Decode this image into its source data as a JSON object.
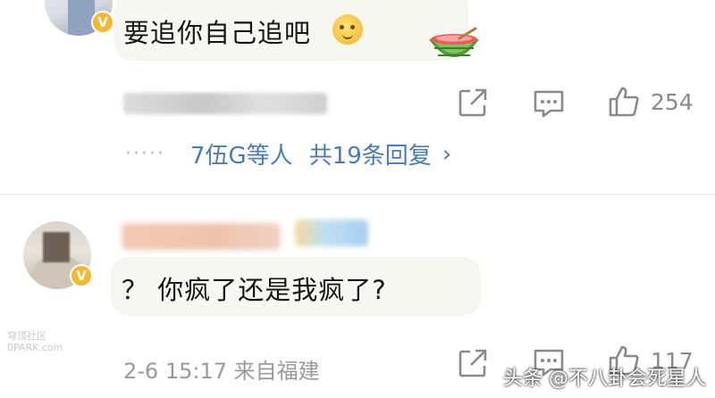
{
  "comment1": {
    "text": "要追你自己追吧",
    "like_count": "254",
    "replies": {
      "dots": "·····",
      "users": "7伍G等人",
      "total": "共19条回复",
      "arrow": "›"
    }
  },
  "comment2": {
    "text": "？ 你疯了还是我疯了?",
    "meta": "2-6 15:17  来自福建",
    "like_count": "117"
  },
  "watermarks": {
    "left_line1": "穹顶社区",
    "left_line2": "0PARK.com",
    "right": "头条 @不八卦会死星人"
  },
  "icons": {
    "share": "share-icon",
    "comment": "comment-icon",
    "like": "thumbs-up-icon",
    "verified": "verified-badge-icon"
  },
  "colors": {
    "link_blue": "#4a7bb8",
    "meta_gray": "#9a9a9a",
    "verified_gold": "#f5b82e"
  }
}
